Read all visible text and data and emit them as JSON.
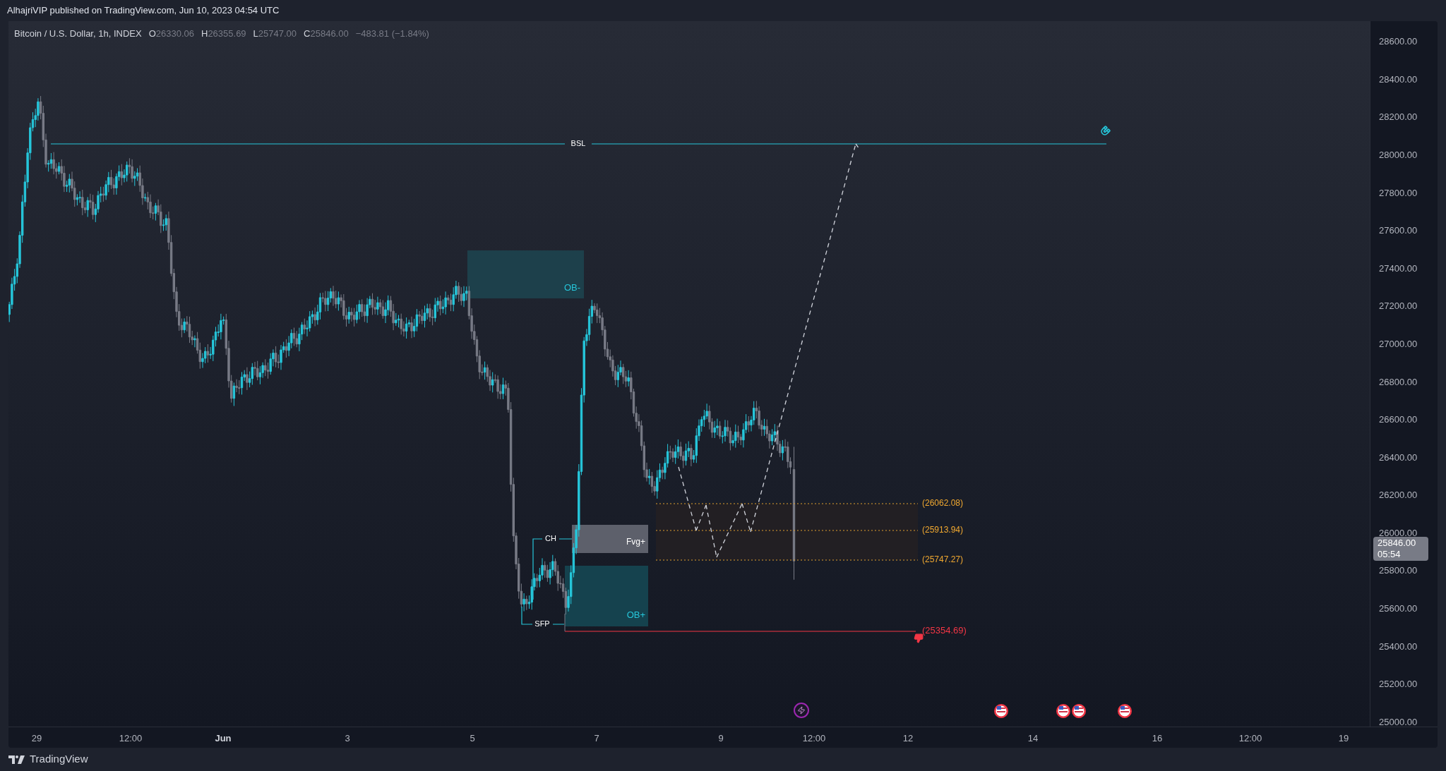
{
  "header": {
    "text": "AlhajriVIP published on TradingView.com, Jun 10, 2023 04:54 UTC"
  },
  "legend": {
    "symbol": "Bitcoin / U.S. Dollar, 1h, INDEX",
    "values": [
      {
        "label": "O",
        "value": "26330.06"
      },
      {
        "label": "H",
        "value": "26355.69"
      },
      {
        "label": "L",
        "value": "25747.00"
      },
      {
        "label": "C",
        "value": "25846.00"
      }
    ],
    "change": "−483.81 (−1.84%)"
  },
  "annotations": {
    "bsl": "BSL",
    "ob_minus": "OB-",
    "fvg_plus": "Fvg+",
    "ob_plus": "OB+",
    "ch": "CH",
    "sfp": "SFP",
    "zone_levels": [
      "(26062.08)",
      "(25913.94)",
      "(25747.27)"
    ],
    "stop_level": "(25354.69)"
  },
  "price_axis": {
    "labels": [
      "28600.00",
      "28400.00",
      "28200.00",
      "28000.00",
      "27800.00",
      "27600.00",
      "27400.00",
      "27200.00",
      "27000.00",
      "26800.00",
      "26600.00",
      "26400.00",
      "26200.00",
      "26000.00",
      "25800.00",
      "25600.00",
      "25400.00",
      "25200.00",
      "25000.00"
    ],
    "current_price": "25846.00",
    "countdown": "05:54"
  },
  "time_axis": [
    {
      "label": "29",
      "bold": false
    },
    {
      "label": "12:00",
      "bold": false
    },
    {
      "label": "Jun",
      "bold": true
    },
    {
      "label": "3",
      "bold": false
    },
    {
      "label": "5",
      "bold": false
    },
    {
      "label": "7",
      "bold": false
    },
    {
      "label": "9",
      "bold": false
    },
    {
      "label": "12:00",
      "bold": false
    },
    {
      "label": "12",
      "bold": false
    },
    {
      "label": "14",
      "bold": false
    },
    {
      "label": "16",
      "bold": false
    },
    {
      "label": "12:00",
      "bold": false
    },
    {
      "label": "19",
      "bold": false
    }
  ],
  "footer": {
    "brand": "TradingView"
  }
}
